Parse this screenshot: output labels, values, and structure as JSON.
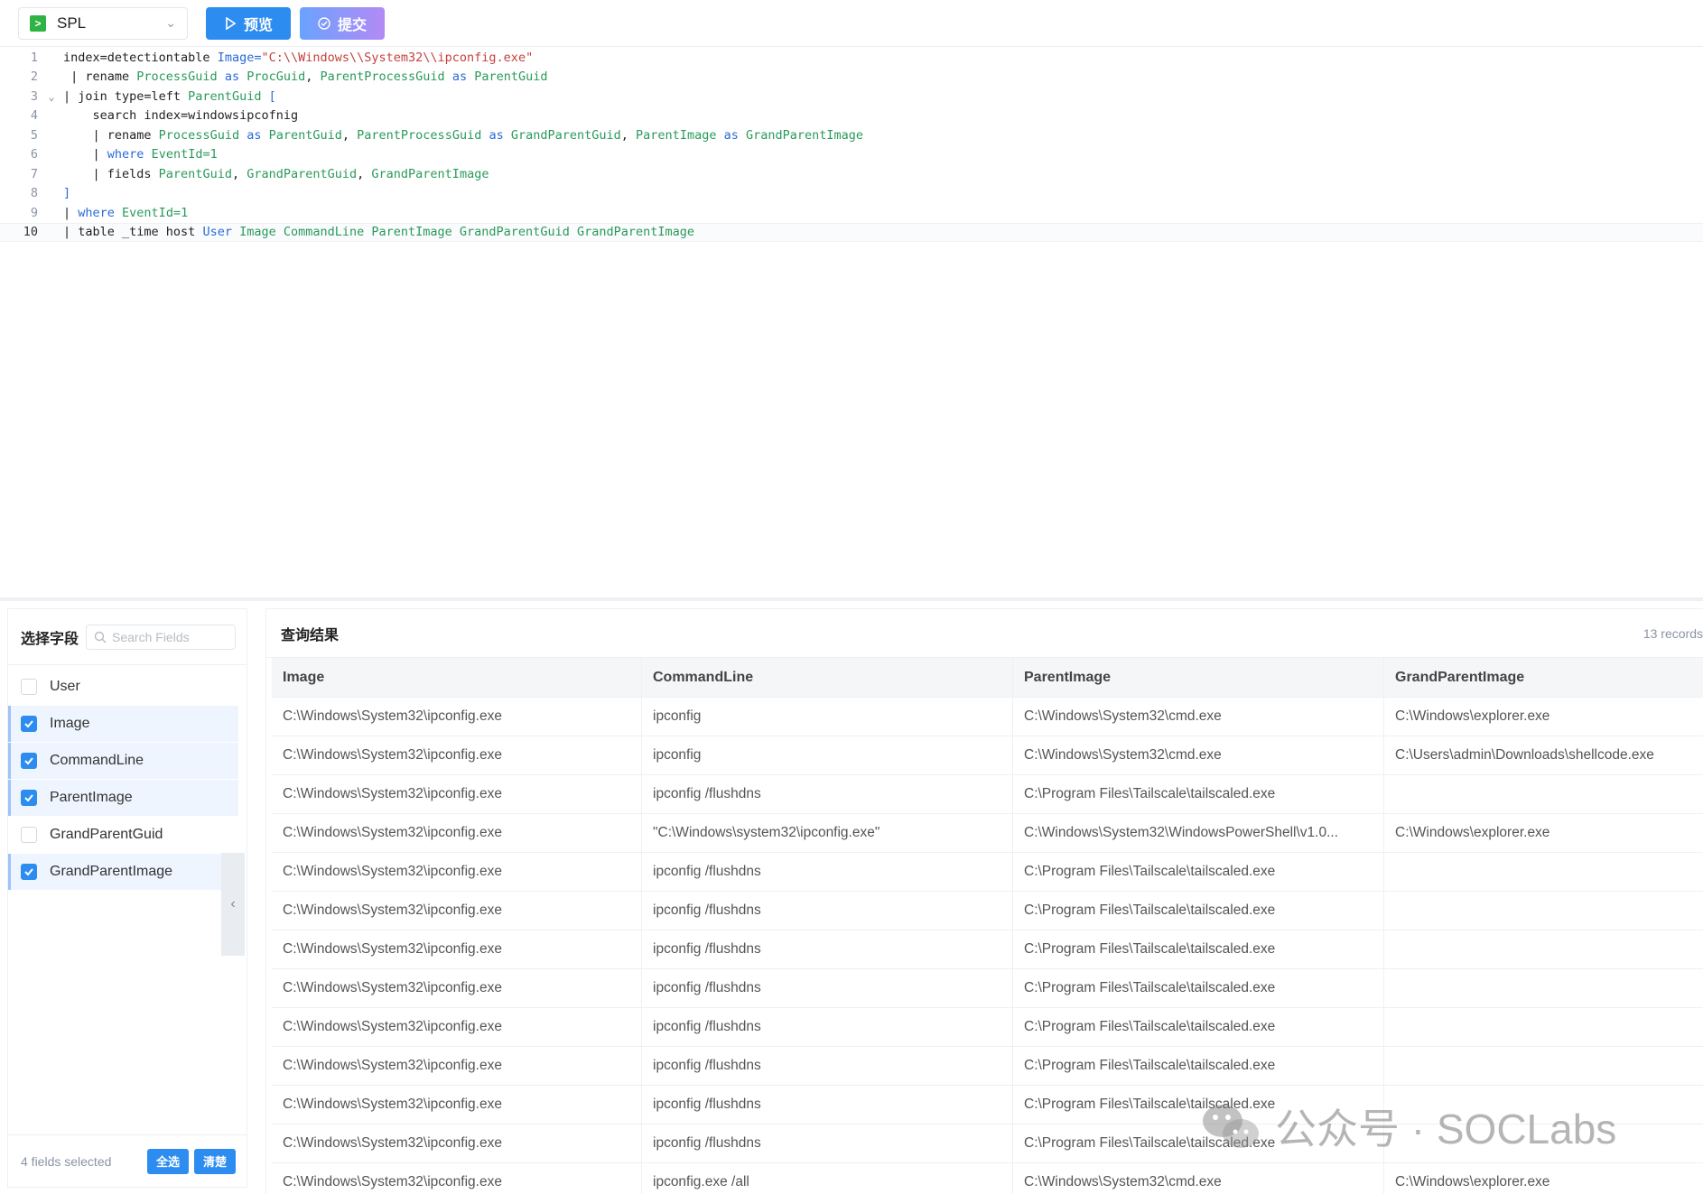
{
  "toolbar": {
    "language": "SPL",
    "lang_icon_glyph": ">",
    "preview_label": "预览",
    "submit_label": "提交"
  },
  "editor": {
    "lines": [
      {
        "num": "1",
        "fold": "",
        "segs": [
          [
            "code",
            "index=detectiontable "
          ],
          [
            "kw",
            "Image="
          ],
          [
            "str",
            "\"C:\\\\Windows\\\\System32\\\\ipconfig.exe\""
          ]
        ]
      },
      {
        "num": "2",
        "fold": "",
        "segs": [
          [
            "pipe",
            " | rename "
          ],
          [
            "id",
            "ProcessGuid "
          ],
          [
            "kw",
            "as "
          ],
          [
            "id",
            "ProcGuid"
          ],
          [
            "code",
            ", "
          ],
          [
            "id",
            "ParentProcessGuid "
          ],
          [
            "kw",
            "as "
          ],
          [
            "id",
            "ParentGuid"
          ]
        ]
      },
      {
        "num": "3",
        "fold": "⌄",
        "segs": [
          [
            "pipe",
            "| join type=left "
          ],
          [
            "id",
            "ParentGuid "
          ],
          [
            "kw",
            "["
          ]
        ]
      },
      {
        "num": "4",
        "fold": "",
        "segs": [
          [
            "code",
            "    search index=windowsipcofnig"
          ]
        ]
      },
      {
        "num": "5",
        "fold": "",
        "segs": [
          [
            "pipe",
            "    | rename "
          ],
          [
            "id",
            "ProcessGuid "
          ],
          [
            "kw",
            "as "
          ],
          [
            "id",
            "ParentGuid"
          ],
          [
            "code",
            ", "
          ],
          [
            "id",
            "ParentProcessGuid "
          ],
          [
            "kw",
            "as "
          ],
          [
            "id",
            "GrandParentGuid"
          ],
          [
            "code",
            ", "
          ],
          [
            "id",
            "ParentImage "
          ],
          [
            "kw",
            "as "
          ],
          [
            "id",
            "GrandParentImage"
          ]
        ]
      },
      {
        "num": "6",
        "fold": "",
        "segs": [
          [
            "pipe",
            "    | "
          ],
          [
            "kw",
            "where "
          ],
          [
            "id",
            "EventId=1"
          ]
        ]
      },
      {
        "num": "7",
        "fold": "",
        "segs": [
          [
            "pipe",
            "    | fields "
          ],
          [
            "id",
            "ParentGuid"
          ],
          [
            "code",
            ", "
          ],
          [
            "id",
            "GrandParentGuid"
          ],
          [
            "code",
            ", "
          ],
          [
            "id",
            "GrandParentImage"
          ]
        ]
      },
      {
        "num": "8",
        "fold": "",
        "segs": [
          [
            "kw",
            "]"
          ]
        ]
      },
      {
        "num": "9",
        "fold": "",
        "segs": [
          [
            "pipe",
            "| "
          ],
          [
            "kw",
            "where "
          ],
          [
            "id",
            "EventId=1"
          ]
        ]
      },
      {
        "num": "10",
        "fold": "",
        "segs": [
          [
            "pipe",
            "| table _time host "
          ],
          [
            "kw",
            "User "
          ],
          [
            "id",
            "Image CommandLine ParentImage GrandParentGuid GrandParentImage"
          ]
        ]
      }
    ]
  },
  "fields": {
    "title": "选择字段",
    "search_placeholder": "Search Fields",
    "items": [
      {
        "label": "User",
        "checked": false
      },
      {
        "label": "Image",
        "checked": true
      },
      {
        "label": "CommandLine",
        "checked": true
      },
      {
        "label": "ParentImage",
        "checked": true
      },
      {
        "label": "GrandParentGuid",
        "checked": false
      },
      {
        "label": "GrandParentImage",
        "checked": true
      }
    ],
    "collapse_glyph": "‹",
    "selected_count": "4 fields selected",
    "select_all_label": "全选",
    "clear_label": "清楚"
  },
  "results": {
    "title": "查询结果",
    "record_count": "13 records",
    "columns": [
      "Image",
      "CommandLine",
      "ParentImage",
      "GrandParentImage"
    ],
    "rows": [
      [
        "C:\\Windows\\System32\\ipconfig.exe",
        "ipconfig",
        "C:\\Windows\\System32\\cmd.exe",
        "C:\\Windows\\explorer.exe"
      ],
      [
        "C:\\Windows\\System32\\ipconfig.exe",
        "ipconfig",
        "C:\\Windows\\System32\\cmd.exe",
        "C:\\Users\\admin\\Downloads\\shellcode.exe"
      ],
      [
        "C:\\Windows\\System32\\ipconfig.exe",
        "ipconfig /flushdns",
        "C:\\Program Files\\Tailscale\\tailscaled.exe",
        ""
      ],
      [
        "C:\\Windows\\System32\\ipconfig.exe",
        "\"C:\\Windows\\system32\\ipconfig.exe\"",
        "C:\\Windows\\System32\\WindowsPowerShell\\v1.0...",
        "C:\\Windows\\explorer.exe"
      ],
      [
        "C:\\Windows\\System32\\ipconfig.exe",
        "ipconfig /flushdns",
        "C:\\Program Files\\Tailscale\\tailscaled.exe",
        ""
      ],
      [
        "C:\\Windows\\System32\\ipconfig.exe",
        "ipconfig /flushdns",
        "C:\\Program Files\\Tailscale\\tailscaled.exe",
        ""
      ],
      [
        "C:\\Windows\\System32\\ipconfig.exe",
        "ipconfig /flushdns",
        "C:\\Program Files\\Tailscale\\tailscaled.exe",
        ""
      ],
      [
        "C:\\Windows\\System32\\ipconfig.exe",
        "ipconfig /flushdns",
        "C:\\Program Files\\Tailscale\\tailscaled.exe",
        ""
      ],
      [
        "C:\\Windows\\System32\\ipconfig.exe",
        "ipconfig /flushdns",
        "C:\\Program Files\\Tailscale\\tailscaled.exe",
        ""
      ],
      [
        "C:\\Windows\\System32\\ipconfig.exe",
        "ipconfig /flushdns",
        "C:\\Program Files\\Tailscale\\tailscaled.exe",
        ""
      ],
      [
        "C:\\Windows\\System32\\ipconfig.exe",
        "ipconfig /flushdns",
        "C:\\Program Files\\Tailscale\\tailscaled.exe",
        ""
      ],
      [
        "C:\\Windows\\System32\\ipconfig.exe",
        "ipconfig /flushdns",
        "C:\\Program Files\\Tailscale\\tailscaled.exe",
        ""
      ],
      [
        "C:\\Windows\\System32\\ipconfig.exe",
        "ipconfig.exe /all",
        "C:\\Windows\\System32\\cmd.exe",
        "C:\\Windows\\explorer.exe"
      ]
    ]
  },
  "watermark": {
    "text": "公众号 · SOCLabs",
    "icon": "wechat-icon"
  },
  "colors": {
    "accent": "#2d8cf0",
    "keyword": "#2a6ad8",
    "identifier": "#2a9a5a",
    "string": "#c4413d"
  }
}
